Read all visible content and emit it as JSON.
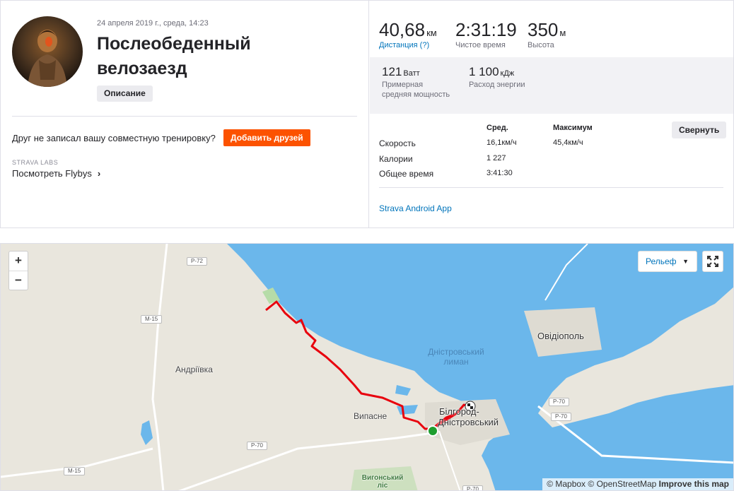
{
  "activity": {
    "date": "24 апреля 2019 г., среда, 14:23",
    "title": "Послеобеденный велозаезд",
    "description_button": "Описание"
  },
  "friends": {
    "prompt": "Друг не записал вашу совместную тренировку?",
    "add_button": "Добавить друзей"
  },
  "labs": {
    "label": "STRAVA LABS",
    "flybys_link": "Посмотреть Flybys"
  },
  "main_stats": [
    {
      "value": "40,68",
      "unit": "км",
      "label": "Дистанция (?)"
    },
    {
      "value": "2:31:19",
      "unit": "",
      "label": "Чистое время"
    },
    {
      "value": "350",
      "unit": "м",
      "label": "Высота"
    }
  ],
  "secondary_stats": [
    {
      "value": "121",
      "unit": "Ватт",
      "label": "Примерная средняя мощность"
    },
    {
      "value": "1 100",
      "unit": "кДж",
      "label": "Расход энергии"
    }
  ],
  "details": {
    "col_avg": "Сред.",
    "col_max": "Максимум",
    "collapse_button": "Свернуть",
    "rows": [
      {
        "label": "Скорость",
        "avg": "16,1км/ч",
        "max": "45,4км/ч"
      },
      {
        "label": "Калории",
        "avg": "1 227",
        "max": ""
      },
      {
        "label": "Общее время",
        "avg": "3:41:30",
        "max": ""
      }
    ],
    "device": "Strava Android App"
  },
  "map": {
    "zoom_in": "+",
    "zoom_out": "−",
    "style_select": "Рельеф",
    "attribution_mapbox": "© Mapbox",
    "attribution_osm": "© OpenStreetMap",
    "attribution_improve": "Improve this map",
    "labels": {
      "andriivka": "Андріївка",
      "vypasne": "Випасне",
      "ovidiopol": "Овідіополь",
      "liman_line1": "Дністровський",
      "liman_line2": "лиман",
      "city_line1": "Білгород-",
      "city_line2": "Дністровський",
      "forest_line1": "Вигонський",
      "forest_line2": "ліс"
    },
    "road_shields": {
      "r72": "Р-72",
      "m15_top": "М-15",
      "m15_bottom": "М-15",
      "r70_left": "Р-70",
      "r70_right_a": "Р-70",
      "r70_right_b": "Р-70",
      "r70_bottom": "Р-70"
    },
    "colors": {
      "route": "#e8000d",
      "water": "#6bb7eb",
      "land": "#e9e6dd",
      "start": "#1e9e2f"
    }
  }
}
